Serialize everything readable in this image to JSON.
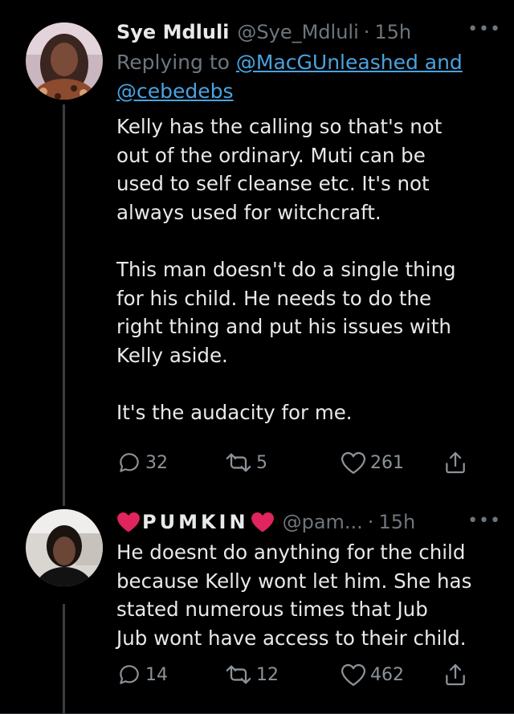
{
  "tweets": [
    {
      "display_name": "Sye Mdluli",
      "handle": "@Sye_Mdluli",
      "separator": "·",
      "time": "15h",
      "more": "•••",
      "replying_prefix": "Replying to",
      "replying_mention_1": "@MacGUnleashed and",
      "replying_mention_2": "@cebedebs",
      "paragraphs": [
        "Kelly has the calling so that's not\nout of the ordinary. Muti can be\nused to self cleanse etc. It's not\nalways used for witchcraft.",
        "This man doesn't do a single thing\nfor his child. He needs to do the\nright thing and put his issues with\nKelly aside.",
        "It's the audacity for me."
      ],
      "replies": "32",
      "retweets": "5",
      "likes": "261"
    },
    {
      "display_name": "PUMKIN",
      "handle": "@pam...",
      "separator": "·",
      "time": "15h",
      "more": "•••",
      "paragraphs": [
        "He doesnt do anything for the child\nbecause Kelly wont let him. She has\nstated numerous times that Jub\nJub wont have access to their child."
      ],
      "replies": "14",
      "retweets": "12",
      "likes": "462"
    }
  ],
  "icons": {
    "reply": "reply-icon",
    "retweet": "retweet-icon",
    "like": "heart-icon",
    "share": "share-icon",
    "emoji_heart": "red-heart-icon"
  },
  "colors": {
    "background": "#000000",
    "text": "#e7e9ea",
    "muted": "#6e767d",
    "link": "#4aa3df",
    "emoji_red": "#e0245e"
  }
}
